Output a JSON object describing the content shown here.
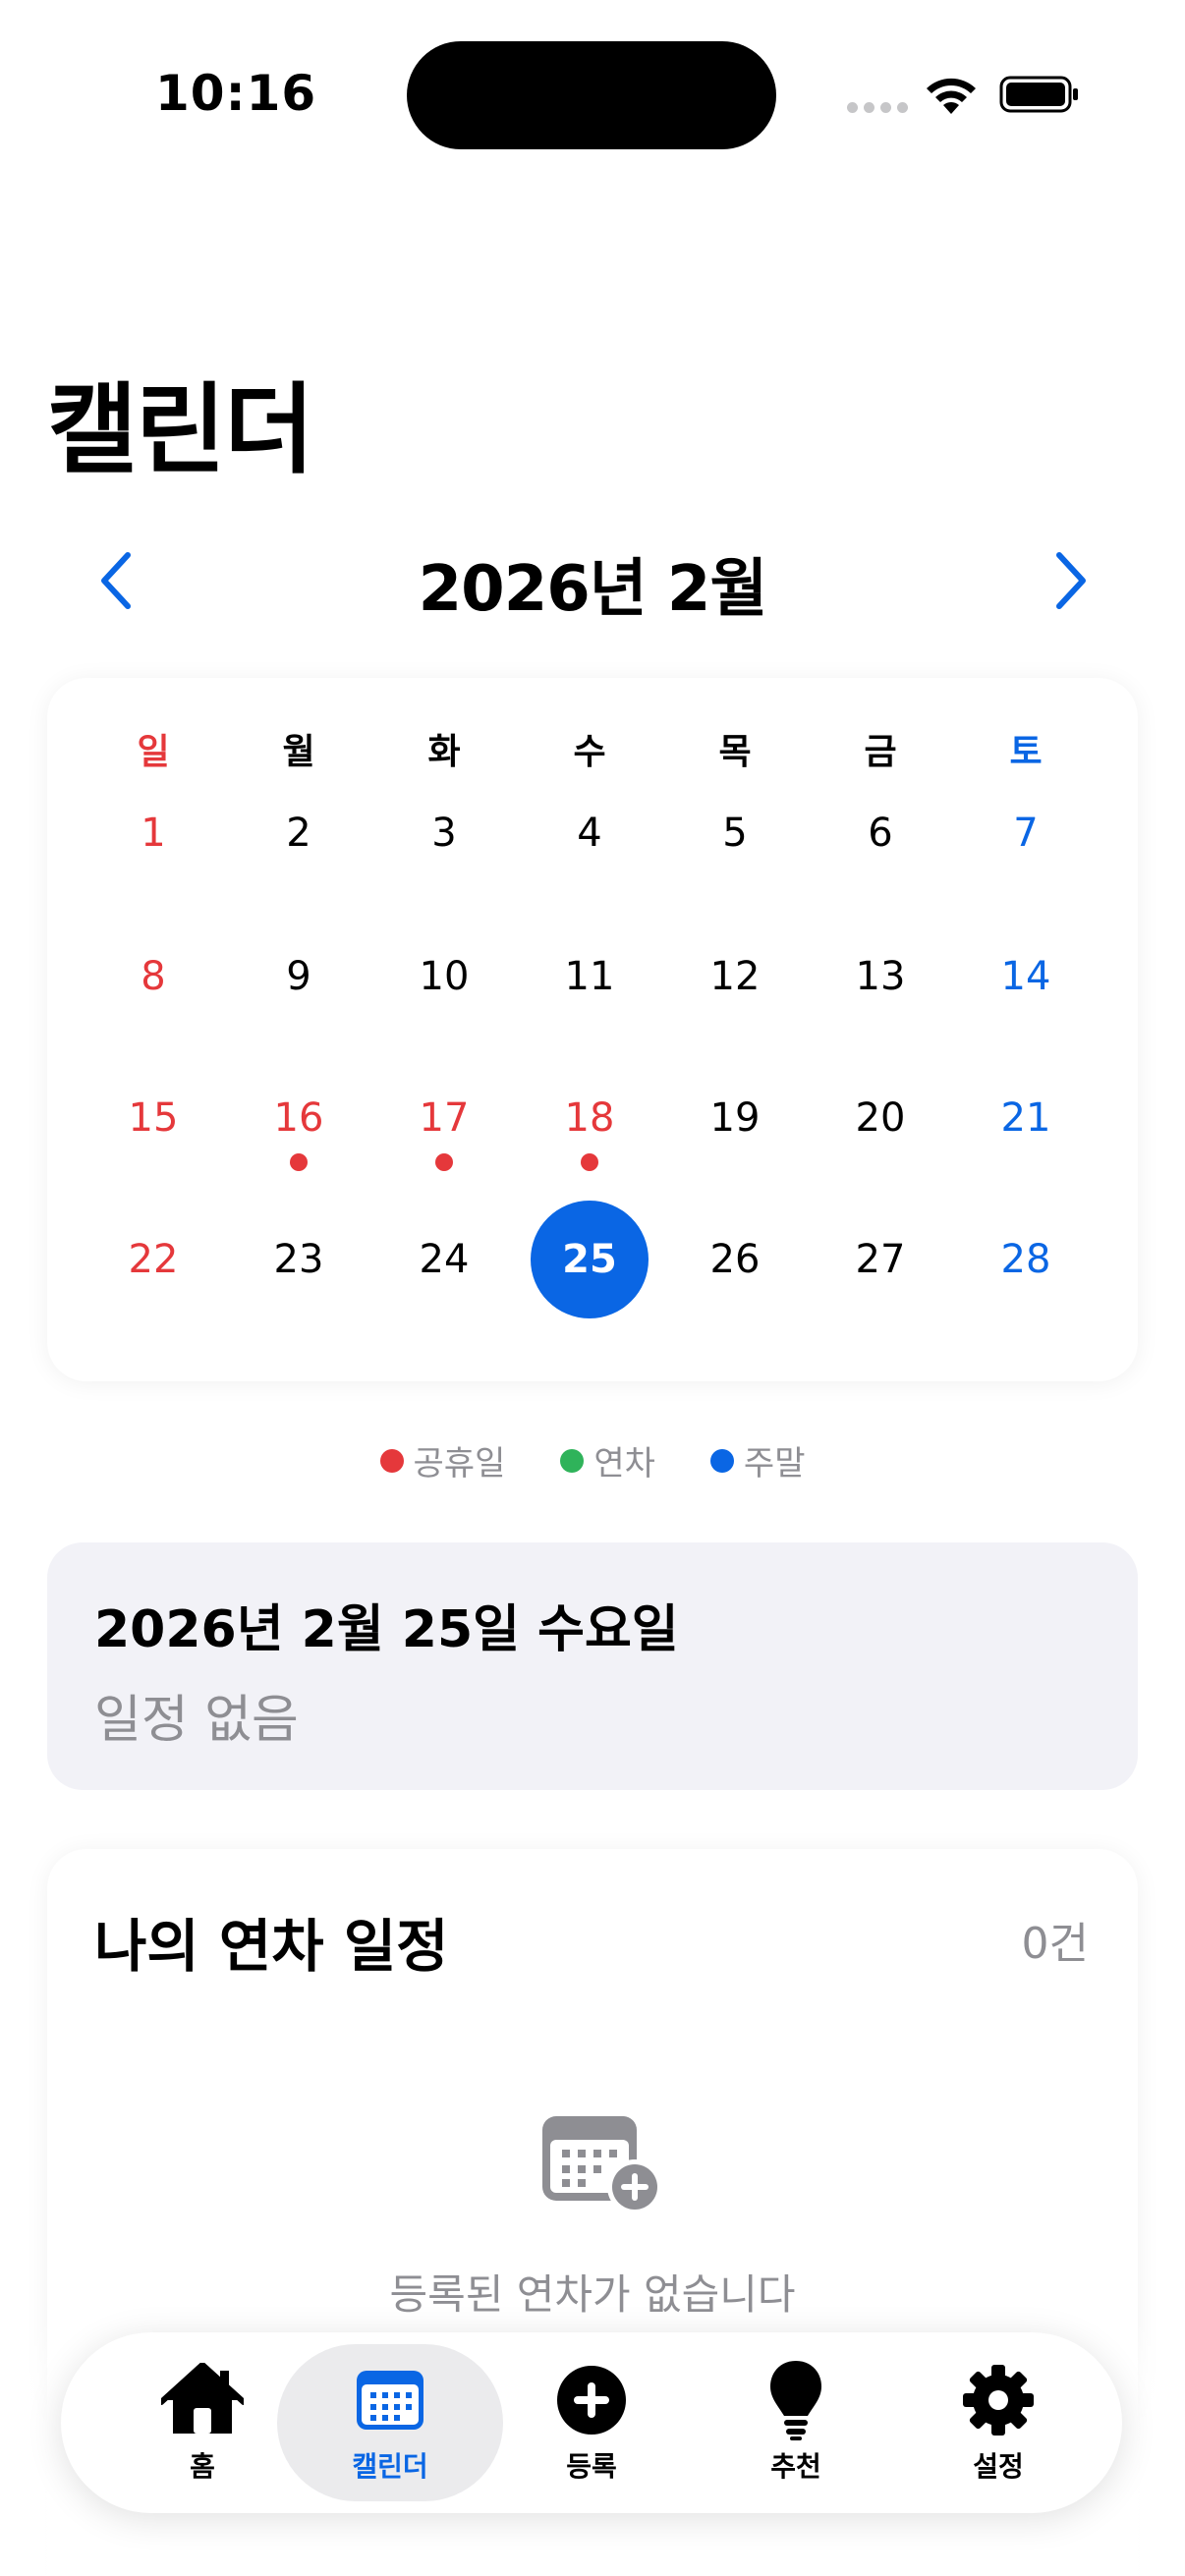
{
  "status_bar": {
    "time": "10:16"
  },
  "page": {
    "title": "캘린더"
  },
  "month_nav": {
    "title": "2026년 2월"
  },
  "calendar": {
    "weekdays": [
      "일",
      "월",
      "화",
      "수",
      "목",
      "금",
      "토"
    ],
    "weeks": [
      [
        "1",
        "2",
        "3",
        "4",
        "5",
        "6",
        "7"
      ],
      [
        "8",
        "9",
        "10",
        "11",
        "12",
        "13",
        "14"
      ],
      [
        "15",
        "16",
        "17",
        "18",
        "19",
        "20",
        "21"
      ],
      [
        "22",
        "23",
        "24",
        "25",
        "26",
        "27",
        "28"
      ]
    ],
    "holidays": [
      "16",
      "17",
      "18"
    ],
    "selected": "25"
  },
  "legend": [
    {
      "label": "공휴일",
      "color": "#e5383b"
    },
    {
      "label": "연차",
      "color": "#2fb35a"
    },
    {
      "label": "주말",
      "color": "#0a66e4"
    }
  ],
  "selected_date": {
    "title": "2026년 2월 25일 수요일",
    "empty_text": "일정 없음"
  },
  "leave_list": {
    "title": "나의 연차 일정",
    "count": "0건",
    "empty_text": "등록된 연차가 없습니다",
    "empty_icon": "calendar-plus-icon"
  },
  "tabbar": {
    "tabs": [
      {
        "label": "홈",
        "icon": "house-icon"
      },
      {
        "label": "캘린더",
        "icon": "calendar-icon",
        "active": true
      },
      {
        "label": "등록",
        "icon": "plus-circle-icon"
      },
      {
        "label": "추천",
        "icon": "lightbulb-icon"
      },
      {
        "label": "설정",
        "icon": "gear-icon"
      }
    ]
  },
  "colors": {
    "accent": "#0a66e4",
    "holiday": "#e5383b",
    "secondary_text": "#8e8e93"
  }
}
